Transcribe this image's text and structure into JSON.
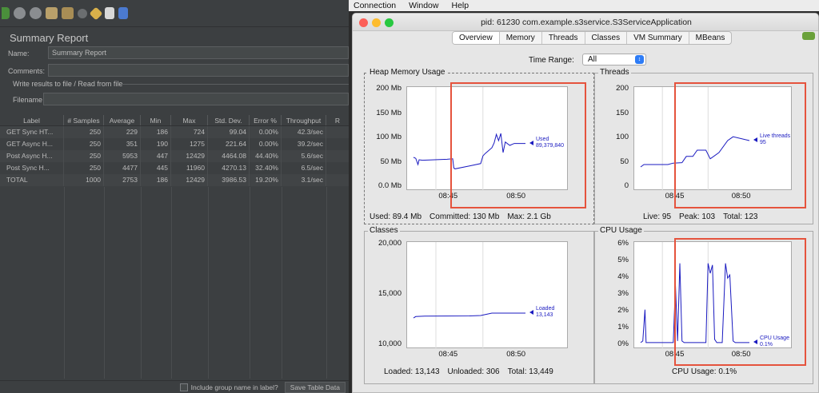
{
  "jmeter": {
    "title": "Summary Report",
    "name_label": "Name:",
    "name_value": "Summary Report",
    "comments_label": "Comments:",
    "write_results_label": "Write results to file / Read from file",
    "filename_label": "Filename",
    "table": {
      "headers": [
        "Label",
        "# Samples",
        "Average",
        "Min",
        "Max",
        "Std. Dev.",
        "Error %",
        "Throughput",
        "R"
      ],
      "rows": [
        [
          "GET Sync HT...",
          "250",
          "229",
          "186",
          "724",
          "99.04",
          "0.00%",
          "42.3/sec"
        ],
        [
          "GET Async H...",
          "250",
          "351",
          "190",
          "1275",
          "221.64",
          "0.00%",
          "39.2/sec"
        ],
        [
          "Post Async H...",
          "250",
          "5953",
          "447",
          "12429",
          "4464.08",
          "44.40%",
          "5.6/sec"
        ],
        [
          "Post Sync H...",
          "250",
          "4477",
          "445",
          "11960",
          "4270.13",
          "32.40%",
          "6.5/sec"
        ],
        [
          "TOTAL",
          "1000",
          "2753",
          "186",
          "12429",
          "3986.53",
          "19.20%",
          "3.1/sec"
        ]
      ]
    },
    "include_group_label": "Include group name in label?",
    "save_table_label": "Save Table Data"
  },
  "menubar": {
    "items": [
      "Connection",
      "Window",
      "Help"
    ]
  },
  "window": {
    "title": "pid: 61230 com.example.s3service.S3ServiceApplication",
    "tabs": [
      "Overview",
      "Memory",
      "Threads",
      "Classes",
      "VM Summary",
      "MBeans"
    ],
    "active_tab": "Overview",
    "time_range_label": "Time Range:",
    "time_range_value": "All"
  },
  "colors": {
    "series": "#1a1ac0",
    "highlight": "#e5533d"
  },
  "chart_data": [
    {
      "type": "line",
      "title": "Heap Memory Usage",
      "y_ticks": [
        "200 Mb",
        "150 Mb",
        "100 Mb",
        "50 Mb",
        "0.0 Mb"
      ],
      "x_ticks": [
        "08:45",
        "08:50"
      ],
      "ylim": [
        0,
        200
      ],
      "legend": "Used\n89,379,840",
      "series": [
        {
          "name": "Used",
          "x": [
            0,
            0.02,
            0.04,
            0.05,
            0.08,
            0.3,
            0.35,
            0.36,
            0.37,
            0.5,
            0.6,
            0.62,
            0.64,
            0.7,
            0.72,
            0.74,
            0.76,
            0.78,
            0.8,
            0.82,
            0.86,
            0.9,
            1.0
          ],
          "values": [
            60,
            58,
            45,
            55,
            54,
            56,
            57,
            38,
            36,
            42,
            47,
            63,
            68,
            80,
            90,
            108,
            95,
            110,
            70,
            92,
            85,
            89,
            89
          ]
        }
      ],
      "footer": [
        "Used: 89.4 Mb",
        "Committed: 130 Mb",
        "Max: 2.1 Gb"
      ]
    },
    {
      "type": "line",
      "title": "Threads",
      "y_ticks": [
        "200",
        "150",
        "100",
        "50",
        "0"
      ],
      "x_ticks": [
        "08:45",
        "08:50"
      ],
      "ylim": [
        0,
        200
      ],
      "legend": "Live threads\n95",
      "series": [
        {
          "name": "Live threads",
          "x": [
            0,
            0.03,
            0.25,
            0.3,
            0.38,
            0.42,
            0.48,
            0.52,
            0.6,
            0.64,
            0.72,
            0.8,
            0.85,
            1.0
          ],
          "values": [
            40,
            45,
            45,
            48,
            49,
            62,
            62,
            75,
            75,
            57,
            70,
            95,
            103,
            95
          ]
        }
      ],
      "footer": [
        "Live: 95",
        "Peak: 103",
        "Total: 123"
      ]
    },
    {
      "type": "line",
      "title": "Classes",
      "y_ticks": [
        "20,000",
        "15,000",
        "10,000"
      ],
      "x_ticks": [
        "08:45",
        "08:50"
      ],
      "ylim": [
        10000,
        20000
      ],
      "legend": "Loaded\n13,143",
      "series": [
        {
          "name": "Loaded",
          "x": [
            0,
            0.02,
            0.1,
            0.5,
            0.6,
            0.7,
            1.0
          ],
          "values": [
            12650,
            12800,
            12850,
            12860,
            12900,
            13143,
            13143
          ]
        }
      ],
      "footer": [
        "Loaded: 13,143",
        "Unloaded: 306",
        "Total: 13,449"
      ]
    },
    {
      "type": "line",
      "title": "CPU Usage",
      "y_ticks": [
        "6%",
        "5%",
        "4%",
        "3%",
        "2%",
        "1%",
        "0%"
      ],
      "x_ticks": [
        "08:45",
        "08:50"
      ],
      "ylim": [
        0,
        6
      ],
      "legend": "CPU Usage\n0.1%",
      "series": [
        {
          "name": "CPU Usage",
          "x": [
            0,
            0.02,
            0.04,
            0.05,
            0.08,
            0.3,
            0.32,
            0.34,
            0.36,
            0.38,
            0.4,
            0.6,
            0.62,
            0.64,
            0.66,
            0.68,
            0.7,
            0.75,
            0.78,
            0.8,
            0.82,
            0.85,
            0.87,
            1.0
          ],
          "values": [
            0.1,
            0.2,
            2.1,
            0.1,
            0.1,
            0.1,
            3.6,
            0.2,
            4.9,
            0.2,
            0.1,
            0.1,
            4.9,
            4.3,
            4.8,
            0.3,
            0.1,
            0.1,
            4.9,
            4.0,
            4.2,
            0.2,
            0.1,
            0.1
          ]
        }
      ],
      "footer": [
        "CPU Usage: 0.1%"
      ]
    }
  ]
}
